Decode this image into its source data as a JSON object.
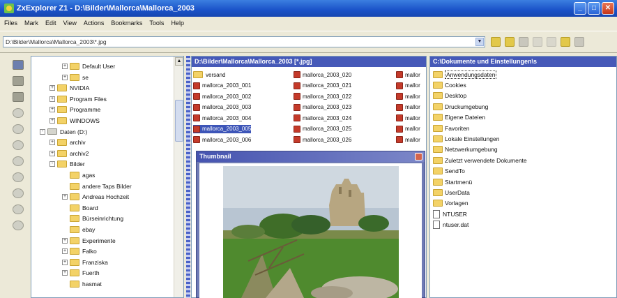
{
  "window": {
    "title": "ZxExplorer Z1 - D:\\Bilder\\Mallorca\\Mallorca_2003"
  },
  "menu": [
    "Files",
    "Mark",
    "Edit",
    "View",
    "Actions",
    "Bookmarks",
    "Tools",
    "Help"
  ],
  "path": {
    "value": "D:\\Bilder\\Mallorca\\Mallorca_2003\\*.jpg"
  },
  "tree": {
    "items": [
      {
        "label": "Default User",
        "expander": "+"
      },
      {
        "label": "se",
        "expander": "+"
      },
      {
        "label": "NVIDIA",
        "expander": "+"
      },
      {
        "label": "Program Files",
        "expander": "+"
      },
      {
        "label": "Programme",
        "expander": "+"
      },
      {
        "label": "WINDOWS",
        "expander": "+"
      },
      {
        "label": "Daten (D:)",
        "expander": "-"
      },
      {
        "label": "archiv",
        "expander": "+"
      },
      {
        "label": "archiv2",
        "expander": "+"
      },
      {
        "label": "Bilder",
        "expander": "-"
      },
      {
        "label": "agas",
        "expander": ""
      },
      {
        "label": "andere Taps Bilder",
        "expander": ""
      },
      {
        "label": "Andreas Hochzeit",
        "expander": "+"
      },
      {
        "label": "Board",
        "expander": ""
      },
      {
        "label": "Bürseinrichtung",
        "expander": ""
      },
      {
        "label": "ebay",
        "expander": ""
      },
      {
        "label": "Experimente",
        "expander": "+"
      },
      {
        "label": "Falko",
        "expander": "+"
      },
      {
        "label": "Franziska",
        "expander": "+"
      },
      {
        "label": "Fuerth",
        "expander": "+"
      },
      {
        "label": "hasmat",
        "expander": ""
      }
    ]
  },
  "mid": {
    "header": "D:\\Bilder\\Mallorca\\Mallorca_2003 [*.jpg]",
    "col1": [
      "versand",
      "mallorca_2003_001",
      "mallorca_2003_002",
      "mallorca_2003_003",
      "mallorca_2003_004",
      "mallorca_2003_005",
      "mallorca_2003_006"
    ],
    "col2": [
      "mallorca_2003_020",
      "mallorca_2003_021",
      "mallorca_2003_022",
      "mallorca_2003_023",
      "mallorca_2003_024",
      "mallorca_2003_025",
      "mallorca_2003_026"
    ],
    "col3": [
      "mallor",
      "mallor",
      "mallor",
      "mallor",
      "mallor",
      "mallor",
      "mallor"
    ]
  },
  "thumbnail": {
    "title": "Thumbnail"
  },
  "right": {
    "header": "C:\\Dokumente und Einstellungen\\s",
    "items": [
      {
        "label": "Anwendungsdaten",
        "icon": "folder"
      },
      {
        "label": "Cookies",
        "icon": "folder"
      },
      {
        "label": "Desktop",
        "icon": "folder"
      },
      {
        "label": "Druckumgebung",
        "icon": "folder"
      },
      {
        "label": "Eigene Dateien",
        "icon": "folder"
      },
      {
        "label": "Favoriten",
        "icon": "folder"
      },
      {
        "label": "Lokale Einstellungen",
        "icon": "folder"
      },
      {
        "label": "Netzwerkumgebung",
        "icon": "folder"
      },
      {
        "label": "Zuletzt verwendete Dokumente",
        "icon": "folder"
      },
      {
        "label": "SendTo",
        "icon": "folder"
      },
      {
        "label": "Startmenü",
        "icon": "folder"
      },
      {
        "label": "UserData",
        "icon": "folder"
      },
      {
        "label": "Vorlagen",
        "icon": "folder"
      },
      {
        "label": "NTUSER",
        "icon": "file"
      },
      {
        "label": "ntuser.dat",
        "icon": "file"
      }
    ]
  }
}
